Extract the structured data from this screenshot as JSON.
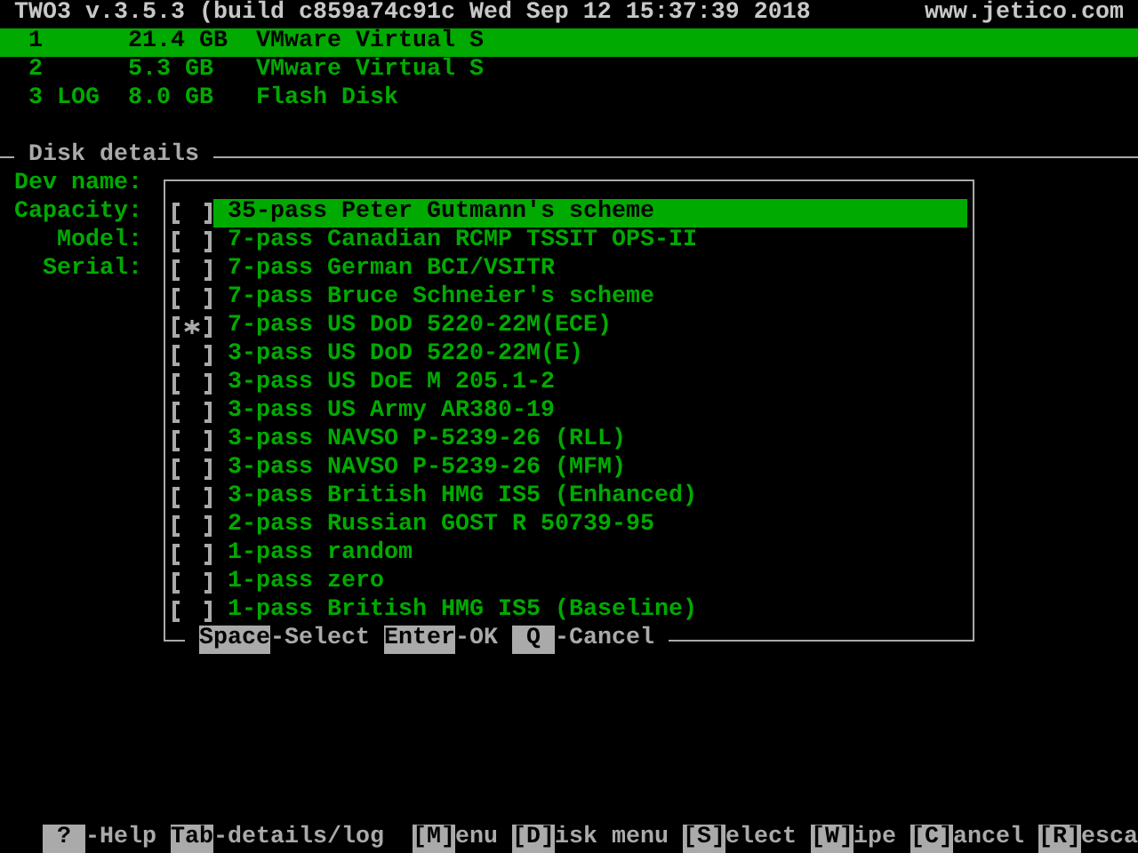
{
  "header": {
    "title": "TWO3 v.3.5.3 (build c859a74c91c Wed Sep 12 15:37:39 2018",
    "website": "www.jetico.com"
  },
  "disks": [
    {
      "id": "1",
      "size": "21.4 GB",
      "name": "VMware Virtual S",
      "selected": true
    },
    {
      "id": "2",
      "size": "5.3 GB",
      "name": "VMware Virtual S",
      "selected": false
    },
    {
      "id": "3 LOG",
      "size": "8.0 GB",
      "name": "Flash Disk",
      "selected": false
    }
  ],
  "details": {
    "title": "Disk details",
    "labels": [
      "Dev name:",
      "Capacity:",
      "Model:",
      "Serial:"
    ]
  },
  "dialog": {
    "items": [
      {
        "label": "35-pass Peter Gutmann's scheme",
        "checked": false,
        "selected": true
      },
      {
        "label": "7-pass Canadian RCMP TSSIT OPS-II",
        "checked": false,
        "selected": false
      },
      {
        "label": "7-pass German BCI/VSITR",
        "checked": false,
        "selected": false
      },
      {
        "label": "7-pass Bruce Schneier's scheme",
        "checked": false,
        "selected": false
      },
      {
        "label": "7-pass US DoD 5220-22M(ECE)",
        "checked": true,
        "selected": false
      },
      {
        "label": "3-pass US DoD 5220-22M(E)",
        "checked": false,
        "selected": false
      },
      {
        "label": "3-pass US DoE M 205.1-2",
        "checked": false,
        "selected": false
      },
      {
        "label": "3-pass US Army AR380-19",
        "checked": false,
        "selected": false
      },
      {
        "label": "3-pass NAVSO P-5239-26 (RLL)",
        "checked": false,
        "selected": false
      },
      {
        "label": "3-pass NAVSO P-5239-26 (MFM)",
        "checked": false,
        "selected": false
      },
      {
        "label": "3-pass British HMG IS5 (Enhanced)",
        "checked": false,
        "selected": false
      },
      {
        "label": "2-pass Russian GOST R 50739-95",
        "checked": false,
        "selected": false
      },
      {
        "label": "1-pass random",
        "checked": false,
        "selected": false
      },
      {
        "label": "1-pass zero",
        "checked": false,
        "selected": false
      },
      {
        "label": "1-pass British HMG IS5 (Baseline)",
        "checked": false,
        "selected": false
      }
    ],
    "hints": [
      {
        "key": "Space",
        "action": "-Select"
      },
      {
        "key": "Enter",
        "action": "-OK"
      },
      {
        "key": "Q",
        "action": "-Cancel"
      }
    ]
  },
  "status_bar": [
    {
      "key": "?",
      "action": "-Help"
    },
    {
      "key": "Tab",
      "action": "-details/log"
    },
    {
      "key": "[M]",
      "action": "enu"
    },
    {
      "key": "[D]",
      "action": "isk menu"
    },
    {
      "key": "[S]",
      "action": "elect"
    },
    {
      "key": "[W]",
      "action": "ipe"
    },
    {
      "key": "[C]",
      "action": "ancel"
    },
    {
      "key": "[R]",
      "action": "esca"
    }
  ]
}
